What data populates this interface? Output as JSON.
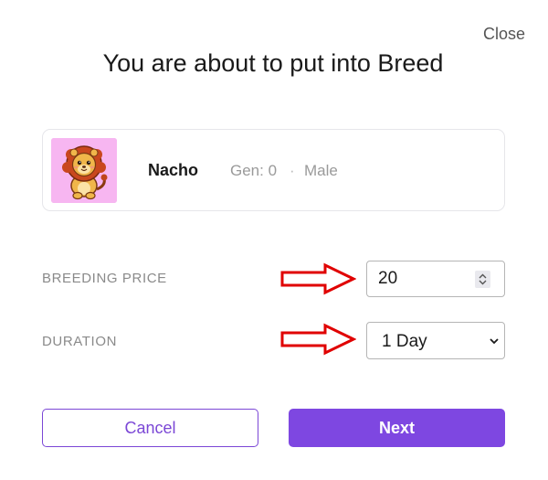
{
  "dialog": {
    "close_label": "Close",
    "title": "You are about to put into Breed"
  },
  "pet": {
    "avatar_icon": "lion-cub-icon",
    "avatar_bg": "#f7b6f1",
    "name": "Nacho",
    "gen": "Gen: 0",
    "separator": "·",
    "gender": "Male"
  },
  "form": {
    "breeding_price": {
      "label": "BREEDING PRICE",
      "value": "20"
    },
    "duration": {
      "label": "DURATION",
      "selected": "1 Day"
    }
  },
  "annotations": {
    "arrow_icon": "red-arrow-right-icon",
    "arrow_color": "#e00000"
  },
  "actions": {
    "cancel_label": "Cancel",
    "next_label": "Next",
    "accent_color": "#7e47e1"
  }
}
